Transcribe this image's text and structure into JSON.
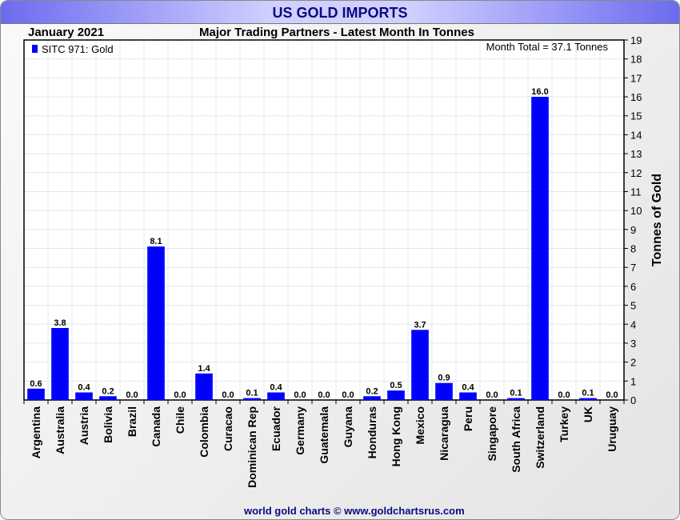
{
  "header": {
    "title": "US GOLD IMPORTS",
    "date": "January 2021",
    "subtitle": "Major Trading Partners - Latest Month In Tonnes",
    "footer": "world gold charts © www.goldchartsrus.com"
  },
  "colors": {
    "bar": "#0000ff",
    "grid": "#dfe8f5"
  },
  "chart_data": {
    "type": "bar",
    "title": "Major Trading Partners - Latest Month In Tonnes",
    "ylabel": "Tonnes of Gold",
    "xlabel": "",
    "ylim": [
      0,
      19
    ],
    "yticks": [
      0,
      1,
      2,
      3,
      4,
      5,
      6,
      7,
      8,
      9,
      10,
      11,
      12,
      13,
      14,
      15,
      16,
      17,
      18,
      19
    ],
    "legend": "SITC 971: Gold",
    "legend_position": "top-left",
    "annotation": "Month Total = 37.1 Tonnes",
    "grid": true,
    "categories": [
      "Argentina",
      "Australia",
      "Austria",
      "Bolivia",
      "Brazil",
      "Canada",
      "Chile",
      "Colombia",
      "Curacao",
      "Dominican Rep",
      "Ecuador",
      "Germany",
      "Guatemala",
      "Guyana",
      "Honduras",
      "Hong Kong",
      "Mexico",
      "Nicaragua",
      "Peru",
      "Singapore",
      "South Africa",
      "Switzerland",
      "Turkey",
      "UK",
      "Uruguay"
    ],
    "values": [
      0.6,
      3.8,
      0.4,
      0.2,
      0.0,
      8.1,
      0.0,
      1.4,
      0.0,
      0.1,
      0.4,
      0.0,
      0.0,
      0.0,
      0.2,
      0.5,
      3.7,
      0.9,
      0.4,
      0.0,
      0.1,
      16.0,
      0.0,
      0.1,
      0.0
    ]
  }
}
